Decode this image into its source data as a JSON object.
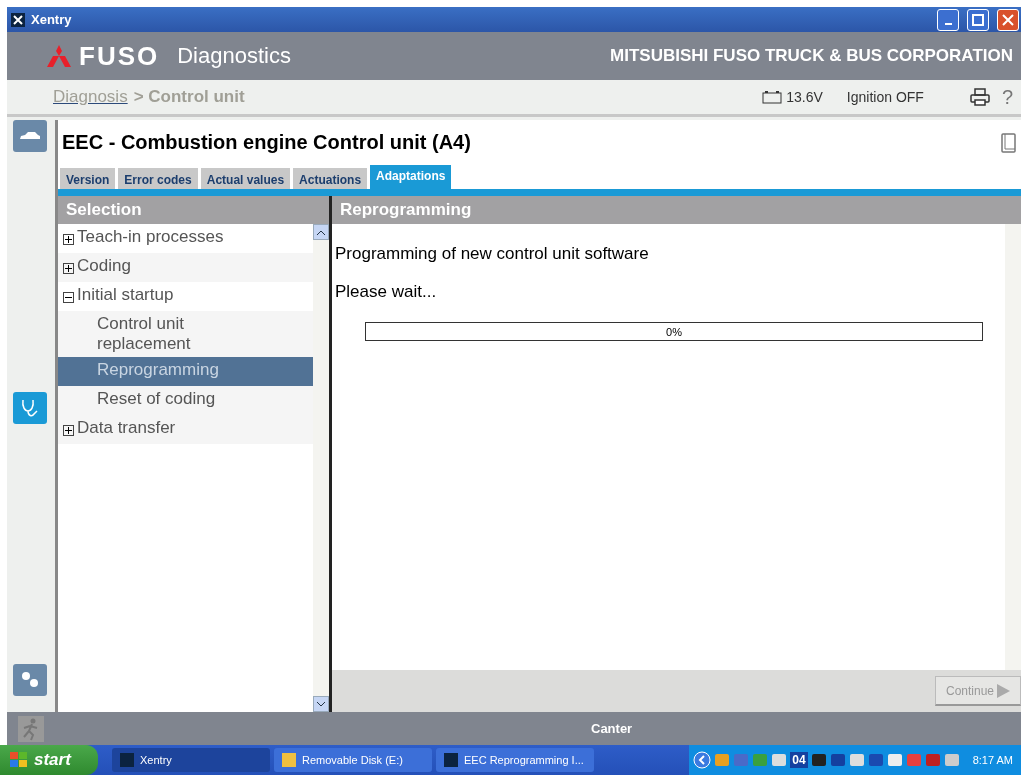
{
  "window": {
    "title": "Xentry"
  },
  "header": {
    "brand": "FUSO",
    "product": "Diagnostics",
    "company": "MITSUBISHI FUSO TRUCK & BUS CORPORATION"
  },
  "breadcrumb": {
    "link": "Diagnosis",
    "current": "> Control unit"
  },
  "status": {
    "voltage": "13.6V",
    "ignition": "Ignition OFF",
    "help": "?"
  },
  "control_unit": {
    "title": "EEC - Combustion engine Control unit (A4)"
  },
  "tabs": [
    {
      "label": "Version",
      "selected": false
    },
    {
      "label": "Error codes",
      "selected": false
    },
    {
      "label": "Actual values",
      "selected": false
    },
    {
      "label": "Actuations",
      "selected": false
    },
    {
      "label": "Adaptations",
      "selected": true
    }
  ],
  "selection": {
    "title": "Selection",
    "items": [
      {
        "label": "Teach-in processes",
        "expanded": false,
        "selected": false
      },
      {
        "label": "Coding",
        "expanded": false,
        "selected": false
      },
      {
        "label": "Initial startup",
        "expanded": true,
        "selected": false,
        "children": [
          {
            "label": "Control unit replacement",
            "selected": false
          },
          {
            "label": "Reprogramming",
            "selected": true
          },
          {
            "label": "Reset of coding",
            "selected": false
          }
        ]
      },
      {
        "label": "Data transfer",
        "expanded": false,
        "selected": false
      }
    ]
  },
  "detail": {
    "title": "Reprogramming",
    "message": "Programming of new control unit software",
    "wait": "Please wait...",
    "progress": {
      "level": 0,
      "reading": "0%"
    },
    "continue": {
      "label": "Continue",
      "disabled": true
    }
  },
  "vehicle": "Canter",
  "taskbar": {
    "start": "start",
    "tasks": [
      {
        "label": "Xentry",
        "selected": true
      },
      {
        "label": "Removable Disk (E:)",
        "selected": false
      },
      {
        "label": "EEC Reprogramming I...",
        "selected": false
      }
    ],
    "tray_number": "04",
    "clock": "8:17 AM"
  }
}
